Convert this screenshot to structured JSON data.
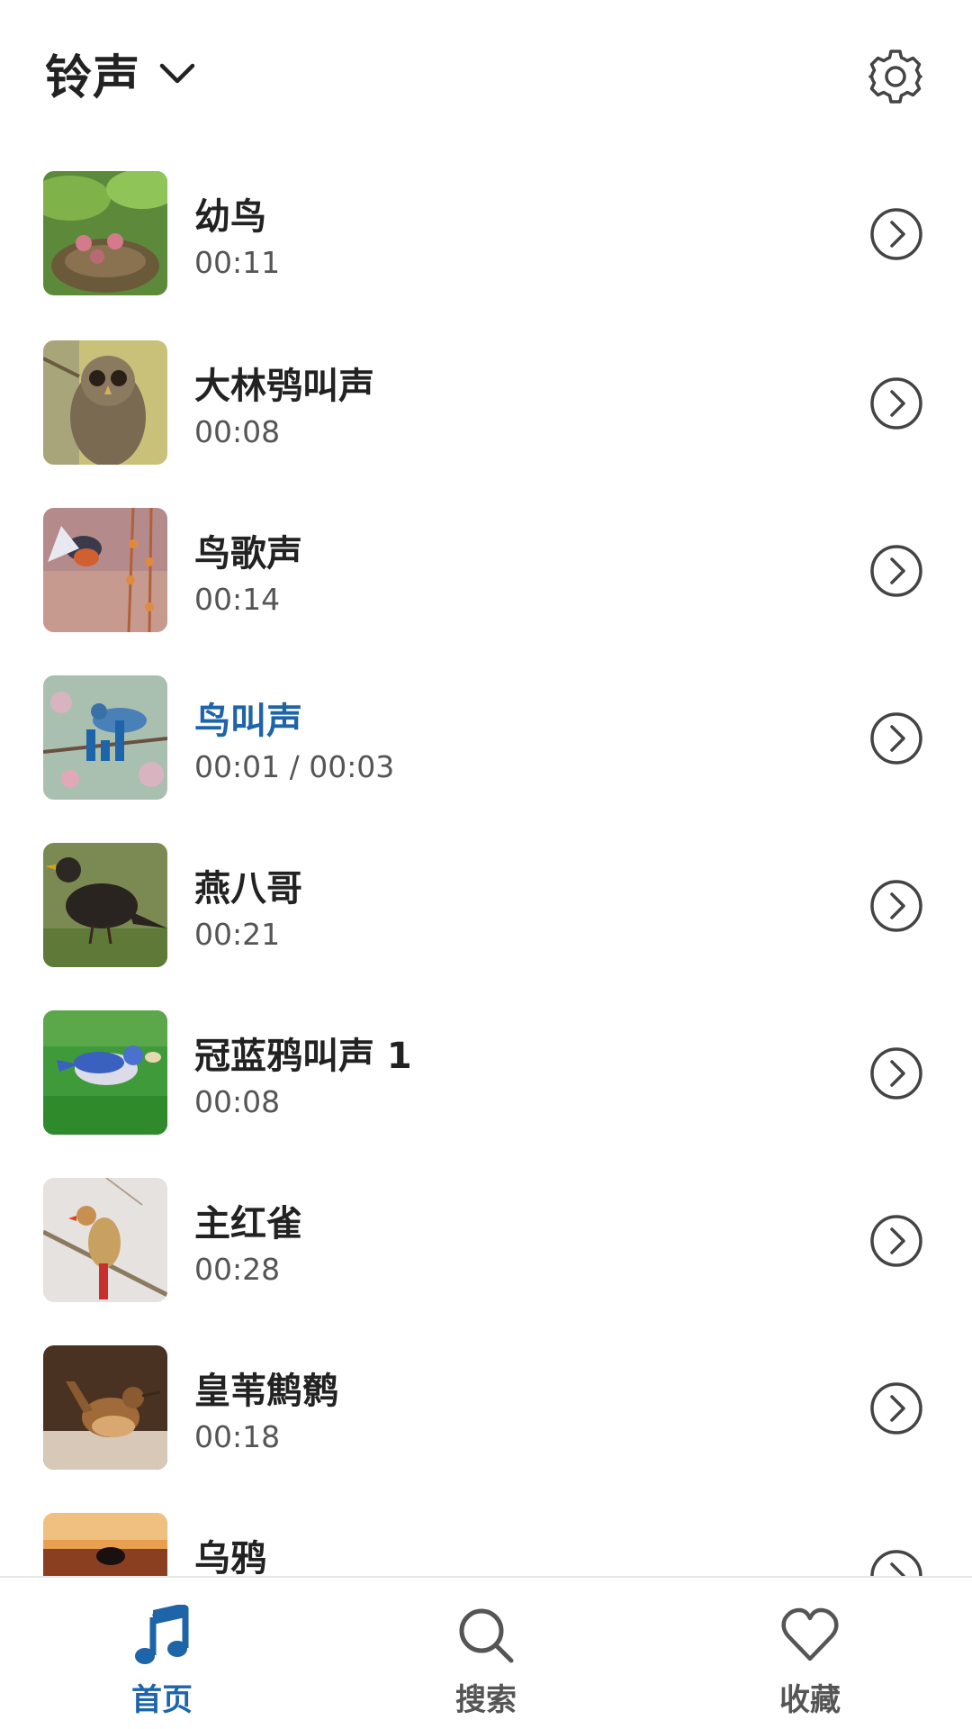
{
  "header": {
    "title": "铃声"
  },
  "colors": {
    "accent": "#1e64a8",
    "text": "#222222",
    "secondary": "#555555"
  },
  "list": {
    "items": [
      {
        "title": "幼鸟",
        "time": "00:11",
        "active": false
      },
      {
        "title": "大林鸮叫声",
        "time": "00:08",
        "active": false
      },
      {
        "title": "鸟歌声",
        "time": "00:14",
        "active": false
      },
      {
        "title": "鸟叫声",
        "time": "00:01 / 00:03",
        "active": true
      },
      {
        "title": "燕八哥",
        "time": "00:21",
        "active": false
      },
      {
        "title": "冠蓝鸦叫声 1",
        "time": "00:08",
        "active": false
      },
      {
        "title": "主红雀",
        "time": "00:28",
        "active": false
      },
      {
        "title": "皇苇鹪鹩",
        "time": "00:18",
        "active": false
      },
      {
        "title": "乌鸦",
        "time": "",
        "active": false
      }
    ]
  },
  "bottom_nav": {
    "items": [
      {
        "label": "首页",
        "icon": "music-note-icon",
        "active": true
      },
      {
        "label": "搜索",
        "icon": "search-icon",
        "active": false
      },
      {
        "label": "收藏",
        "icon": "heart-icon",
        "active": false
      }
    ]
  }
}
